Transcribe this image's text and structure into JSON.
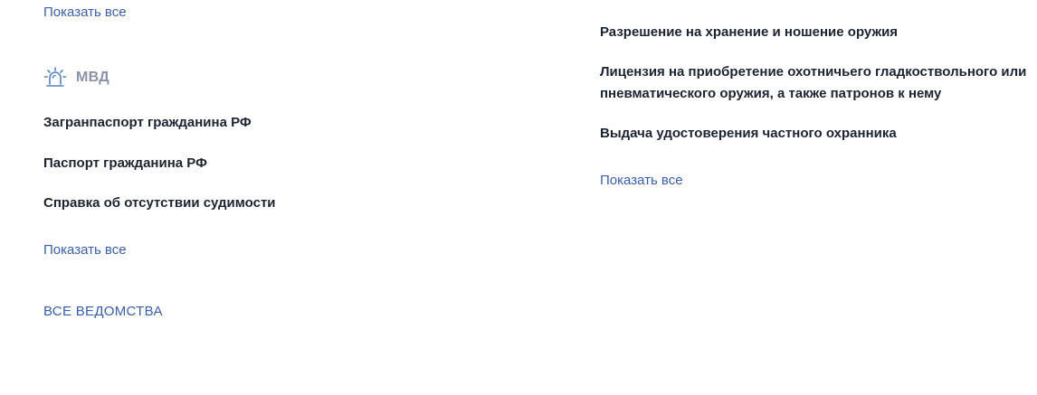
{
  "left": {
    "show_all_top": "Показать все",
    "department": {
      "name": "МВД",
      "icon": "siren-icon",
      "services": [
        "Загранпаспорт гражданина РФ",
        "Паспорт гражданина РФ",
        "Справка об отсутствии судимости"
      ],
      "show_all": "Показать все"
    },
    "all_departments": "ВСЕ ВЕДОМСТВА"
  },
  "right": {
    "services": [
      "Разрешение на хранение и ношение оружия",
      "Лицензия на приобретение охотничьего гладкоствольного или пневматического оружия, а также патронов к нему",
      "Выдача удостоверения частного охранника"
    ],
    "show_all": "Показать все"
  },
  "colors": {
    "link": "#3b5fa8",
    "text": "#1c2331",
    "muted": "#8a93a6",
    "icon": "#5a82c4"
  }
}
